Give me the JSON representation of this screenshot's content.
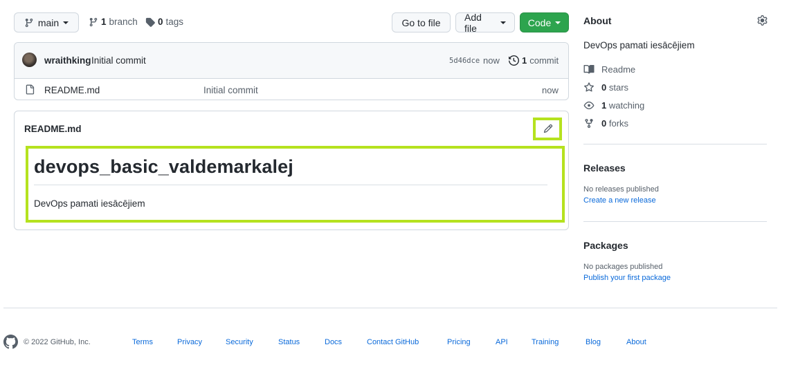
{
  "toolbar": {
    "branch_label": "main",
    "branches_count": "1",
    "branches_label": "branch",
    "tags_count": "0",
    "tags_label": "tags",
    "go_to_file": "Go to file",
    "add_file": "Add file",
    "code": "Code"
  },
  "commit": {
    "author": "wraithking",
    "message": "Initial commit",
    "hash": "5d46dce",
    "time": "now",
    "count": "1",
    "count_label": "commit"
  },
  "files": [
    {
      "name": "README.md",
      "message": "Initial commit",
      "time": "now"
    }
  ],
  "readme": {
    "filename": "README.md",
    "heading": "devops_basic_valdemarkalej",
    "body": "DevOps pamati iesācējiem"
  },
  "sidebar": {
    "about_title": "About",
    "description": "DevOps pamati iesācējiem",
    "readme_label": "Readme",
    "stars_count": "0",
    "stars_label": "stars",
    "watching_count": "1",
    "watching_label": "watching",
    "forks_count": "0",
    "forks_label": "forks",
    "releases_title": "Releases",
    "releases_empty": "No releases published",
    "releases_link": "Create a new release",
    "packages_title": "Packages",
    "packages_empty": "No packages published",
    "packages_link": "Publish your first package"
  },
  "footer": {
    "copyright": "© 2022 GitHub, Inc.",
    "links": [
      "Terms",
      "Privacy",
      "Security",
      "Status",
      "Docs",
      "Contact GitHub",
      "Pricing",
      "API",
      "Training",
      "Blog",
      "About"
    ]
  },
  "colors": {
    "highlight": "#b5e21f",
    "code_button": "#2da44e",
    "link": "#0969da"
  }
}
